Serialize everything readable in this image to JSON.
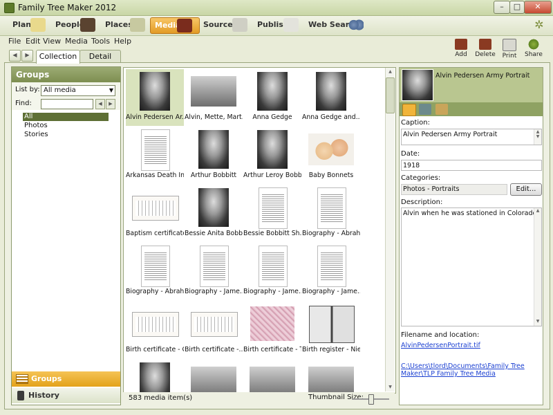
{
  "window": {
    "title": "Family Tree Maker 2012",
    "controls": [
      "–",
      "□",
      "✕"
    ]
  },
  "modules": [
    "Plan",
    "People",
    "Places",
    "Media",
    "Sources",
    "Publish",
    "Web Search"
  ],
  "menu": [
    "File",
    "Edit",
    "View",
    "Media",
    "Tools",
    "Help"
  ],
  "tabs": [
    "Collection",
    "Detail"
  ],
  "toolbar": [
    "Add",
    "Delete",
    "Print",
    "Share"
  ],
  "left": {
    "title": "Groups",
    "list_by_label": "List by:",
    "list_by_value": "All media",
    "find_label": "Find:",
    "find_value": "",
    "items": [
      "All",
      "Photos",
      "Stories"
    ],
    "bottom": [
      "Groups",
      "History"
    ]
  },
  "grid": {
    "items": [
      {
        "caption": "Alvin Pedersen Ar...",
        "kind": "portrait"
      },
      {
        "caption": "Alvin, Mette, Mart...",
        "kind": "photo"
      },
      {
        "caption": "Anna Gedge",
        "kind": "portrait"
      },
      {
        "caption": "Anna Gedge and...",
        "kind": "portrait"
      },
      {
        "caption": "Arkansas Death In...",
        "kind": "doc"
      },
      {
        "caption": "Arthur Bobbitt",
        "kind": "portrait"
      },
      {
        "caption": "Arthur Leroy Bobb...",
        "kind": "portrait"
      },
      {
        "caption": "Baby Bonnets",
        "kind": "bonnet"
      },
      {
        "caption": "Baptism certificate...",
        "kind": "cert"
      },
      {
        "caption": "Bessie Anita Bobb...",
        "kind": "portrait"
      },
      {
        "caption": "Bessie Bobbitt Sh...",
        "kind": "doc"
      },
      {
        "caption": "Biography - Abrah...",
        "kind": "doc"
      },
      {
        "caption": "Biography - Abrah...",
        "kind": "doc"
      },
      {
        "caption": "Biography - Jame...",
        "kind": "doc"
      },
      {
        "caption": "Biography - Jame...",
        "kind": "doc"
      },
      {
        "caption": "Biography - Jame...",
        "kind": "doc"
      },
      {
        "caption": "Birth certificate - C...",
        "kind": "cert"
      },
      {
        "caption": "Birth certificate -...",
        "kind": "cert"
      },
      {
        "caption": "Birth certificate - T...",
        "kind": "pink"
      },
      {
        "caption": "Birth register - Niel...",
        "kind": "register"
      },
      {
        "caption": "",
        "kind": "portrait"
      },
      {
        "caption": "",
        "kind": "photo"
      },
      {
        "caption": "",
        "kind": "photo"
      },
      {
        "caption": "",
        "kind": "photo"
      }
    ],
    "count": "583 media item(s)",
    "thumb_size_label": "Thumbnail Size:"
  },
  "detail": {
    "title": "Alvin Pedersen Army Portrait",
    "caption_label": "Caption:",
    "caption_value": "Alvin Pedersen Army Portrait",
    "date_label": "Date:",
    "date_value": "1918",
    "categories_label": "Categories:",
    "categories_value": "Photos - Portraits",
    "edit_label": "Edit...",
    "description_label": "Description:",
    "description_value": "Alvin when he was stationed in Colorado.",
    "filename_label": "Filename and location:",
    "filename": "AlvinPedersenPortrait.tif",
    "path": "C:\\Users\\tlord\\Documents\\Family Tree Maker\\TLP Family Tree Media"
  }
}
